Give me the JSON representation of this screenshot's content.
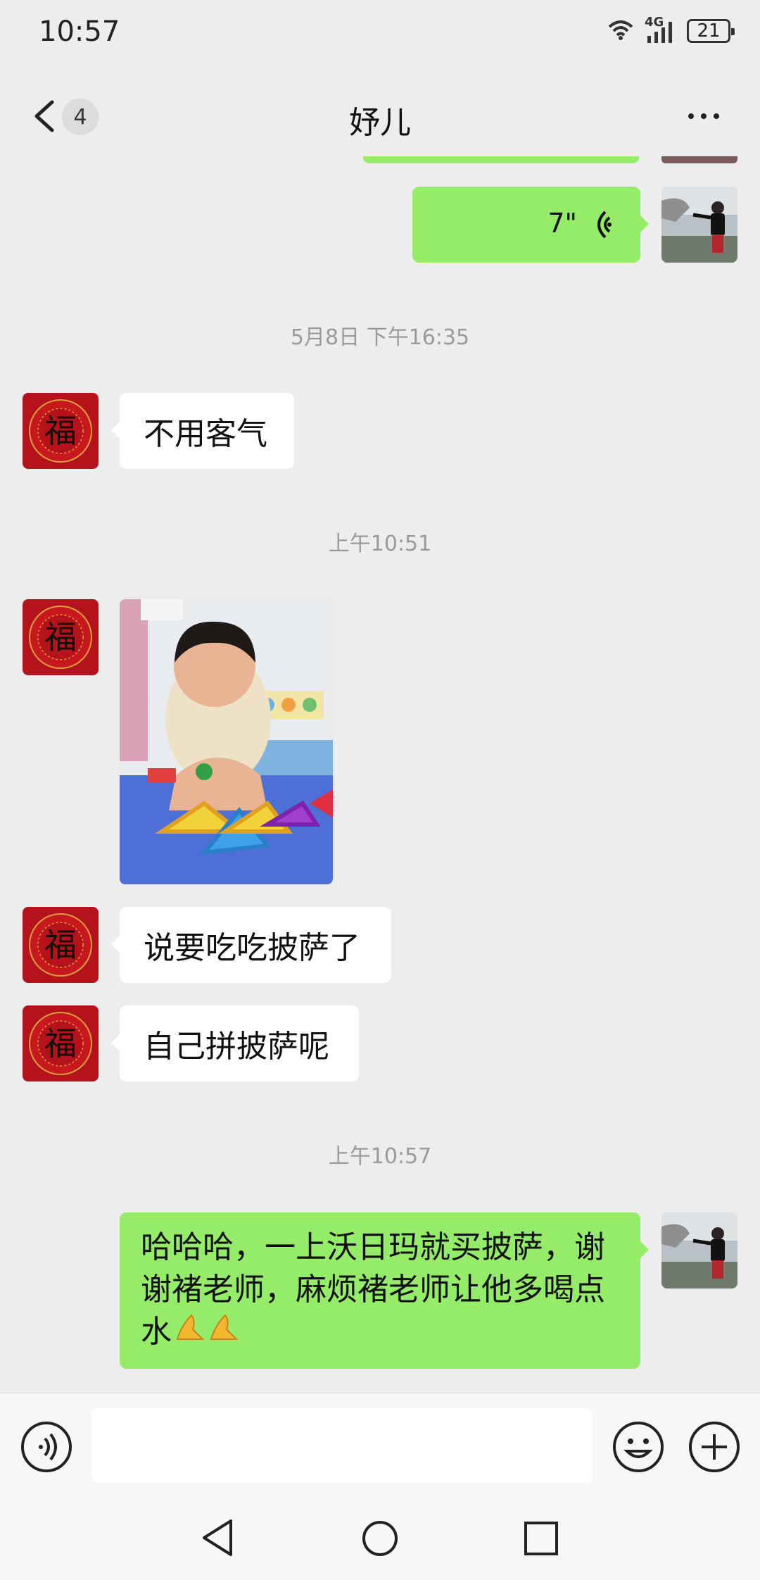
{
  "status_bar": {
    "time": "10:57",
    "network": "4G",
    "battery": "21",
    "icons": [
      "wifi-icon",
      "signal-icon",
      "battery-icon"
    ]
  },
  "header": {
    "unread_count": "4",
    "title": "妤儿",
    "icons": [
      "back-arrow-icon",
      "more-dots-icon"
    ]
  },
  "messages": [
    {
      "type": "voice",
      "side": "out",
      "duration": "7\""
    },
    {
      "type": "time",
      "text": "5月8日 下午16:35"
    },
    {
      "type": "text",
      "side": "in",
      "text": "不用客气"
    },
    {
      "type": "time",
      "text": "上午10:51"
    },
    {
      "type": "image",
      "side": "in",
      "description": "photo"
    },
    {
      "type": "text",
      "side": "in",
      "text": "说要吃吃披萨了"
    },
    {
      "type": "text",
      "side": "in",
      "text": "自己拼披萨呢"
    },
    {
      "type": "time",
      "text": "上午10:57"
    },
    {
      "type": "text",
      "side": "out",
      "text": "哈哈哈，一上沃日玛就买披萨，谢谢褚老师，麻烦褚老师让他多喝点水🙏🙏"
    }
  ],
  "out_message_lines": [
    "哈哈哈，一上沃日玛就买披萨，谢",
    "谢褚老师，麻烦褚老师让他多喝点",
    "水"
  ],
  "colors": {
    "background": "#ededed",
    "bubble_out": "#95ec69",
    "bubble_in": "#ffffff",
    "avatar_red": "#c0161b",
    "time_text": "#9a9a9a"
  },
  "input_bar": {
    "icons": [
      "voice-toggle-icon",
      "emoji-icon",
      "plus-icon"
    ]
  },
  "nav_bar": {
    "icons": [
      "nav-back-icon",
      "nav-home-icon",
      "nav-recents-icon"
    ]
  }
}
